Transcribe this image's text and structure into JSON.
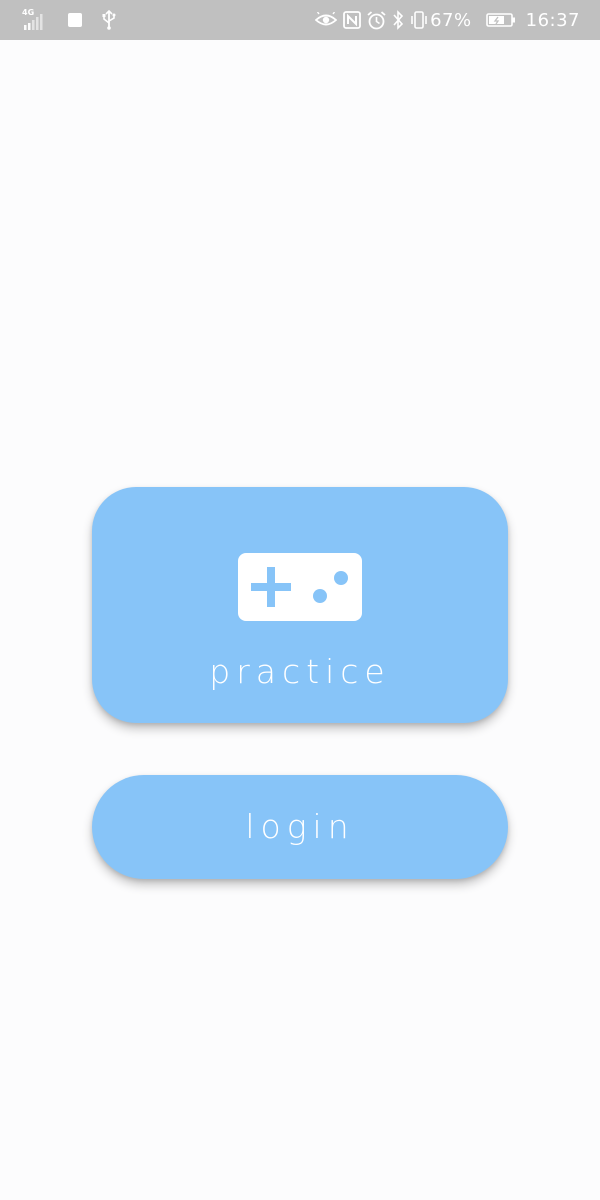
{
  "status_bar": {
    "network_type": "4G",
    "battery_percent": "67%",
    "time": "16:37",
    "icons": [
      "signal-icon",
      "stop-icon",
      "usb-icon",
      "eye-comfort-icon",
      "nfc-icon",
      "alarm-icon",
      "bluetooth-icon",
      "vibrate-icon",
      "battery-icon"
    ]
  },
  "main": {
    "practice_button": {
      "label": "practice",
      "icon": "gamepad-icon"
    },
    "login_button": {
      "label": "login"
    }
  },
  "colors": {
    "button_background": "#87c4f8",
    "button_text": "#ffffff",
    "page_background": "#fcfcfd",
    "status_bar_background": "#c0c0c0"
  }
}
